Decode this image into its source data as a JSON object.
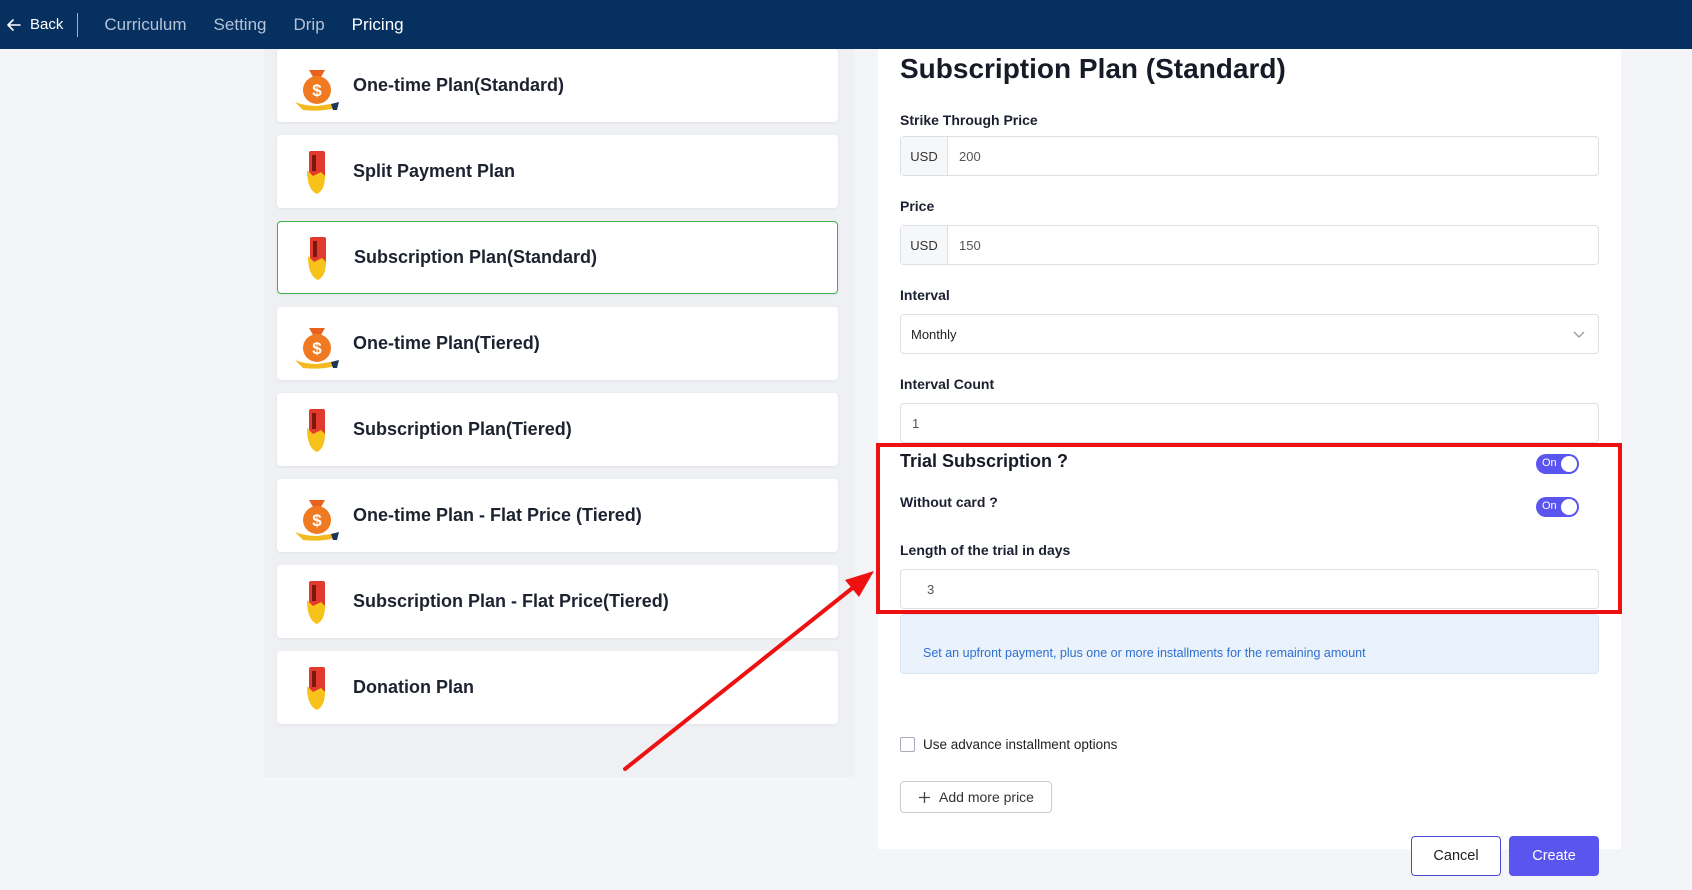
{
  "nav": {
    "back_label": "Back",
    "tabs": [
      "Curriculum",
      "Setting",
      "Drip",
      "Pricing"
    ],
    "active_tab": "Pricing"
  },
  "plans": [
    {
      "label": "One-time Plan(Standard)",
      "icon": "money-bag-icon"
    },
    {
      "label": "Split Payment Plan",
      "icon": "credit-card-hand-icon"
    },
    {
      "label": "Subscription Plan(Standard)",
      "icon": "credit-card-hand-icon",
      "selected": true
    },
    {
      "label": "One-time Plan(Tiered)",
      "icon": "money-bag-icon"
    },
    {
      "label": "Subscription Plan(Tiered)",
      "icon": "credit-card-hand-icon"
    },
    {
      "label": "One-time Plan - Flat Price (Tiered)",
      "icon": "money-bag-icon"
    },
    {
      "label": "Subscription Plan - Flat Price(Tiered)",
      "icon": "credit-card-hand-icon"
    },
    {
      "label": "Donation Plan",
      "icon": "credit-card-hand-icon"
    }
  ],
  "form": {
    "title": "Subscription Plan (Standard)",
    "strike_price_label": "Strike Through Price",
    "strike_currency": "USD",
    "strike_value": "200",
    "price_label": "Price",
    "price_currency": "USD",
    "price_value": "150",
    "interval_label": "Interval",
    "interval_value": "Monthly",
    "interval_count_label": "Interval Count",
    "interval_count_value": "1",
    "trial_label": "Trial Subscription ?",
    "trial_toggle": "On",
    "without_card_label": "Without card ?",
    "without_card_toggle": "On",
    "trial_length_label": "Length of the trial in days",
    "trial_length_value": "3",
    "info_text": "Set an upfront payment, plus one or more installments for the remaining amount",
    "advance_installment_label": "Use advance installment options",
    "add_more_label": "Add more price",
    "cancel_label": "Cancel",
    "create_label": "Create"
  },
  "colors": {
    "nav_bg": "#06305f",
    "accent": "#5b55f0",
    "selected_border": "#3fb24a",
    "annotation": "#ee1111"
  }
}
